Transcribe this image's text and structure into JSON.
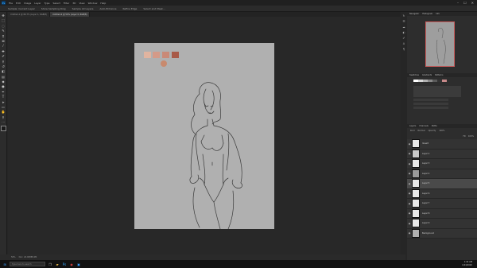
{
  "menu": {
    "logo": "Ps",
    "items": [
      "File",
      "Edit",
      "Image",
      "Layer",
      "Type",
      "Select",
      "Filter",
      "3D",
      "View",
      "Window",
      "Help"
    ]
  },
  "window_controls": {
    "minimize": "–",
    "maximize": "☐",
    "close": "✕"
  },
  "options_bar": [
    "Sample: Current Layer",
    "Show Sampling Ring",
    "Sample All Layers",
    "Auto-Enhance",
    "Refine Edge",
    "Select and Mask..."
  ],
  "tabs": [
    {
      "label": "Untitled-1 @ 66.7% (Layer 1, RGB/8)",
      "active": false
    },
    {
      "label": "Untitled-2 @ 50% (Layer 0, RGB/8)",
      "active": true
    }
  ],
  "tools": [
    "move",
    "marquee",
    "lasso",
    "quick-select",
    "crop",
    "frame",
    "eyedropper",
    "healing",
    "brush",
    "stamp",
    "history-brush",
    "eraser",
    "gradient",
    "blur",
    "dodge",
    "pen",
    "type",
    "path-select",
    "shape",
    "hand",
    "zoom",
    "more"
  ],
  "color_swatches": [
    "#e0b4a0",
    "#d49a88",
    "#c98a78",
    "#b86a58",
    "#a85a48",
    "#c88a6e"
  ],
  "panels": {
    "navigator": {
      "tabs": [
        "Navigator",
        "Histogram",
        "Info"
      ]
    },
    "swatches": {
      "tabs": [
        "Swatches",
        "Gradients",
        "Patterns"
      ]
    },
    "layers": {
      "tabs": [
        "Layers",
        "Channels",
        "Paths"
      ],
      "search_placeholder": "Kind",
      "mode": "Normal",
      "opacity_label": "Opacity",
      "opacity": "100%",
      "fill_label": "Fill",
      "fill": "100%",
      "items": [
        {
          "name": "lineart",
          "selected": false
        },
        {
          "name": "Layer 2",
          "selected": false
        },
        {
          "name": "Layer 3",
          "selected": false
        },
        {
          "name": "Layer 4",
          "selected": false
        },
        {
          "name": "Layer 5",
          "selected": true
        },
        {
          "name": "Layer 6",
          "selected": false
        },
        {
          "name": "Layer 7",
          "selected": false
        },
        {
          "name": "Layer 8",
          "selected": false
        },
        {
          "name": "Layer 9",
          "selected": false
        },
        {
          "name": "Background",
          "selected": false
        }
      ]
    }
  },
  "status": {
    "zoom": "50%",
    "doc": "Doc: 24.9M/88.0M"
  },
  "taskbar": {
    "search_placeholder": "Type here to search",
    "time": "1:42 AM",
    "date": "1/24/2020"
  },
  "canvas": {
    "bg": "#b0b0b0"
  }
}
